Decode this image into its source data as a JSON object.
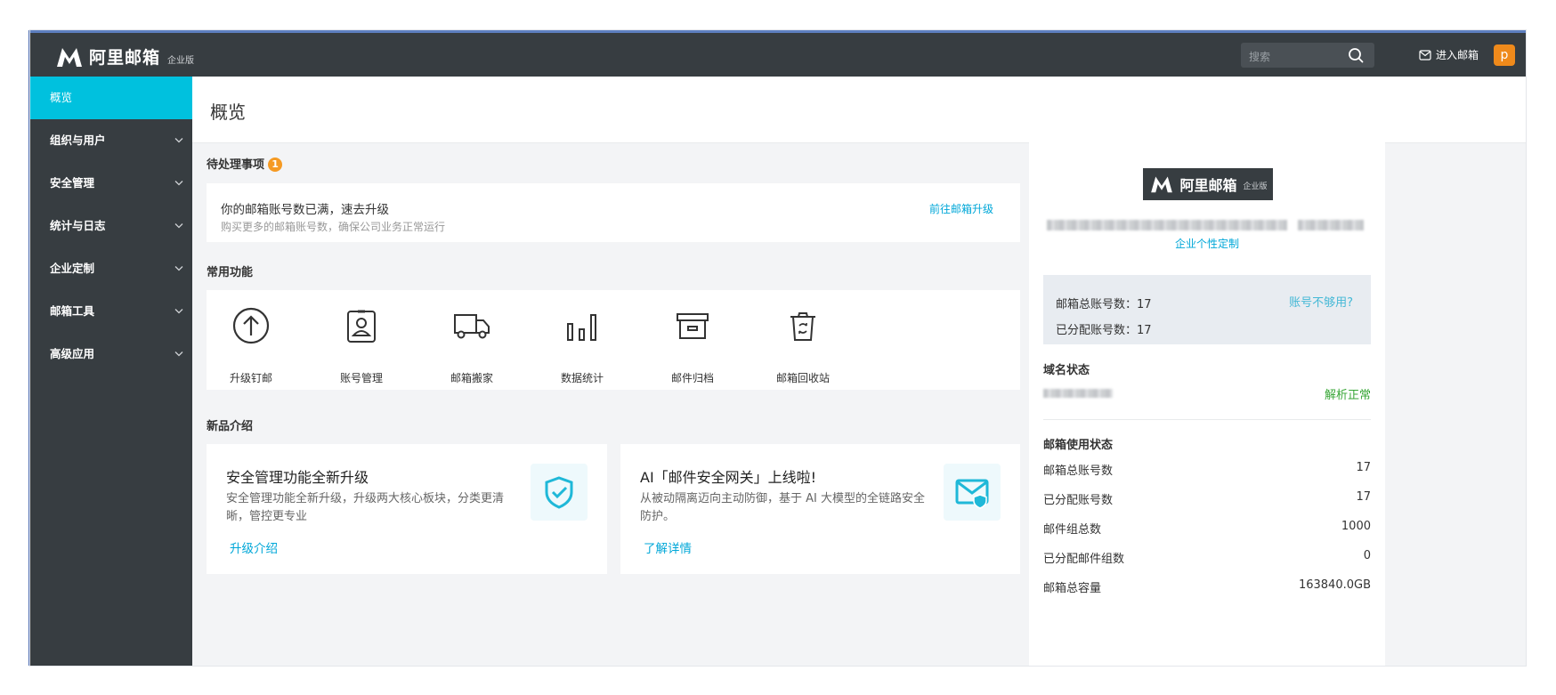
{
  "app": {
    "brand": "阿里邮箱",
    "edition": "企业版"
  },
  "topbar": {
    "search_placeholder": "搜索",
    "enter_mail_label": "进入邮箱",
    "avatar_letter": "p"
  },
  "sidebar": {
    "items": [
      {
        "label": "概览",
        "active": true
      },
      {
        "label": "组织与用户"
      },
      {
        "label": "安全管理"
      },
      {
        "label": "统计与日志"
      },
      {
        "label": "企业定制"
      },
      {
        "label": "邮箱工具"
      },
      {
        "label": "高级应用"
      }
    ]
  },
  "page": {
    "title": "概览"
  },
  "pending": {
    "title": "待处理事项",
    "count": "1",
    "main_text": "你的邮箱账号数已满，速去升级",
    "sub_text": "购买更多的邮箱账号数，确保公司业务正常运行",
    "link_label": "前往邮箱升级"
  },
  "common": {
    "title": "常用功能",
    "items": [
      {
        "label": "升级钉邮",
        "icon": "upgrade-arrow-icon"
      },
      {
        "label": "账号管理",
        "icon": "account-badge-icon"
      },
      {
        "label": "邮箱搬家",
        "icon": "truck-icon"
      },
      {
        "label": "数据统计",
        "icon": "bar-stats-icon"
      },
      {
        "label": "邮件归档",
        "icon": "archive-box-icon"
      },
      {
        "label": "邮箱回收站",
        "icon": "recycle-bin-icon"
      }
    ]
  },
  "news": {
    "title": "新品介绍",
    "cards": [
      {
        "title": "安全管理功能全新升级",
        "desc": "安全管理功能全新升级，升级两大核心板块，分类更清晰，管控更专业",
        "link": "升级介绍",
        "icon": "shield-check-icon"
      },
      {
        "title": "AI「邮件安全网关」上线啦!",
        "desc": "从被动隔离迈向主动防御，基于 AI 大模型的全链路安全防护。",
        "link": "了解详情",
        "icon": "mail-shield-icon"
      }
    ]
  },
  "right_panel": {
    "custom_link": "企业个性定制",
    "accounts": {
      "total_label": "邮箱总账号数：",
      "total_value": "17",
      "assigned_label": "已分配账号数：",
      "assigned_value": "17",
      "link": "账号不够用?"
    },
    "domain": {
      "title": "域名状态",
      "status": "解析正常"
    },
    "usage": {
      "title": "邮箱使用状态",
      "rows": [
        {
          "label": "邮箱总账号数",
          "value": "17"
        },
        {
          "label": "已分配账号数",
          "value": "17"
        },
        {
          "label": "邮件组总数",
          "value": "1000"
        },
        {
          "label": "已分配邮件组数",
          "value": "0"
        },
        {
          "label": "邮箱总容量",
          "value": "163840.0GB"
        }
      ]
    }
  },
  "colors": {
    "topbar": "#373d41",
    "accent": "#00c1de",
    "link": "#00a7d8",
    "ok": "#37a636",
    "badge": "#f59a23",
    "avatar": "#ef8a1b"
  }
}
